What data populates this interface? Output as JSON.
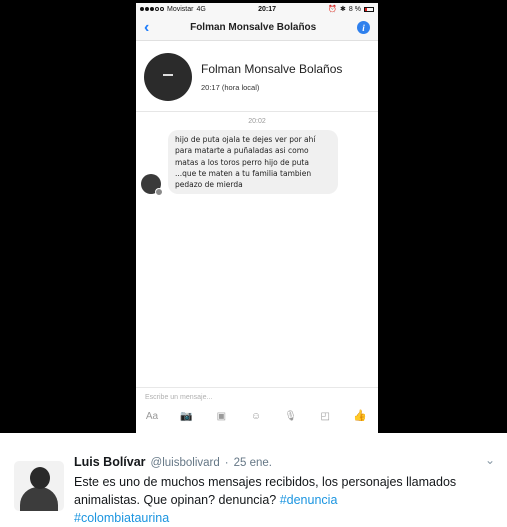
{
  "status_bar": {
    "carrier": "Movistar",
    "network": "4G",
    "time": "20:17",
    "battery": "8 %"
  },
  "chat": {
    "header_title": "Folman Monsalve Bolaños",
    "profile_name": "Folman Monsalve Bolaños",
    "profile_subtitle": "20:17 (hora local)",
    "message_time": "20:02",
    "message_text": "hijo de puta ojala te dejes ver por ahí para matarte a puñaladas asi como matas a los toros perro hijo de puta ...que te maten a tu familia tambien pedazo de mierda",
    "composer_placeholder": "Escribe un mensaje...",
    "composer_aa": "Aa",
    "icons": [
      "back-icon",
      "info-icon",
      "camera-icon",
      "gallery-icon",
      "emoji-icon",
      "microphone-icon",
      "sticker-icon",
      "like-icon"
    ]
  },
  "tweet": {
    "name": "Luis Bolívar",
    "handle": "@luisbolivard",
    "separator": "·",
    "date": "25 ene.",
    "text": "Este es uno de muchos mensajes recibidos, los personajes llamados animalistas. Que opinan? denuncia? ",
    "hashtag_1": "#denuncia",
    "hashtag_2": "#colombiataurina",
    "colors": {
      "link": "#1b95e0",
      "messenger_blue": "#2f80ed"
    }
  }
}
